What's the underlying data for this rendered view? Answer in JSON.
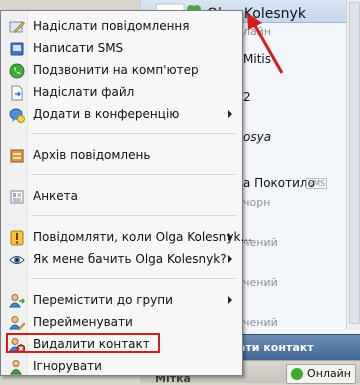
{
  "menu": {
    "items": [
      {
        "label": "Надіслати повідомлення",
        "icon": "pencil-message-icon"
      },
      {
        "label": "Написати SMS",
        "icon": "sms-phone-icon"
      },
      {
        "label": "Подзвонити на комп'ютер",
        "icon": "call-icon"
      },
      {
        "label": "Надіслати файл",
        "icon": "send-file-icon"
      },
      {
        "label": "Додати в конференцію",
        "icon": "conference-add-icon"
      },
      {
        "label": "Архів повідомлень",
        "icon": "archive-icon"
      },
      {
        "label": "Анкета",
        "icon": "profile-card-icon"
      },
      {
        "label": "Повідомляти, коли Olga Kolesnyk...",
        "icon": "notify-icon"
      },
      {
        "label": "Як мене бачить Olga Kolesnyk?",
        "icon": "eye-icon"
      },
      {
        "label": "Перемістити до групи",
        "icon": "move-group-icon"
      },
      {
        "label": "Перейменувати",
        "icon": "rename-icon"
      },
      {
        "label": "Видалити контакт",
        "icon": "delete-contact-icon"
      },
      {
        "label": "Ігнорувати",
        "icon": "ignore-icon"
      }
    ]
  },
  "contacts": {
    "top_contact": "Olga Kolesnyk",
    "rows": [
      {
        "name": "",
        "sub": "лайн"
      },
      {
        "name": "Mitis",
        "sub": ""
      },
      {
        "name": "2",
        "sub": ""
      },
      {
        "name": "osya",
        "sub": ""
      },
      {
        "name": "а Покотило",
        "sub": "чорн"
      },
      {
        "name": "",
        "sub": "чений"
      },
      {
        "name": "",
        "sub": "чений"
      },
      {
        "name": "",
        "sub": "чений"
      }
    ],
    "bottom_bar_label": "ати контакт",
    "status_label": "Онлайн",
    "footer_label": "Мітка"
  },
  "colors": {
    "highlight": "#d81c1c",
    "accent": "#3f6392"
  }
}
